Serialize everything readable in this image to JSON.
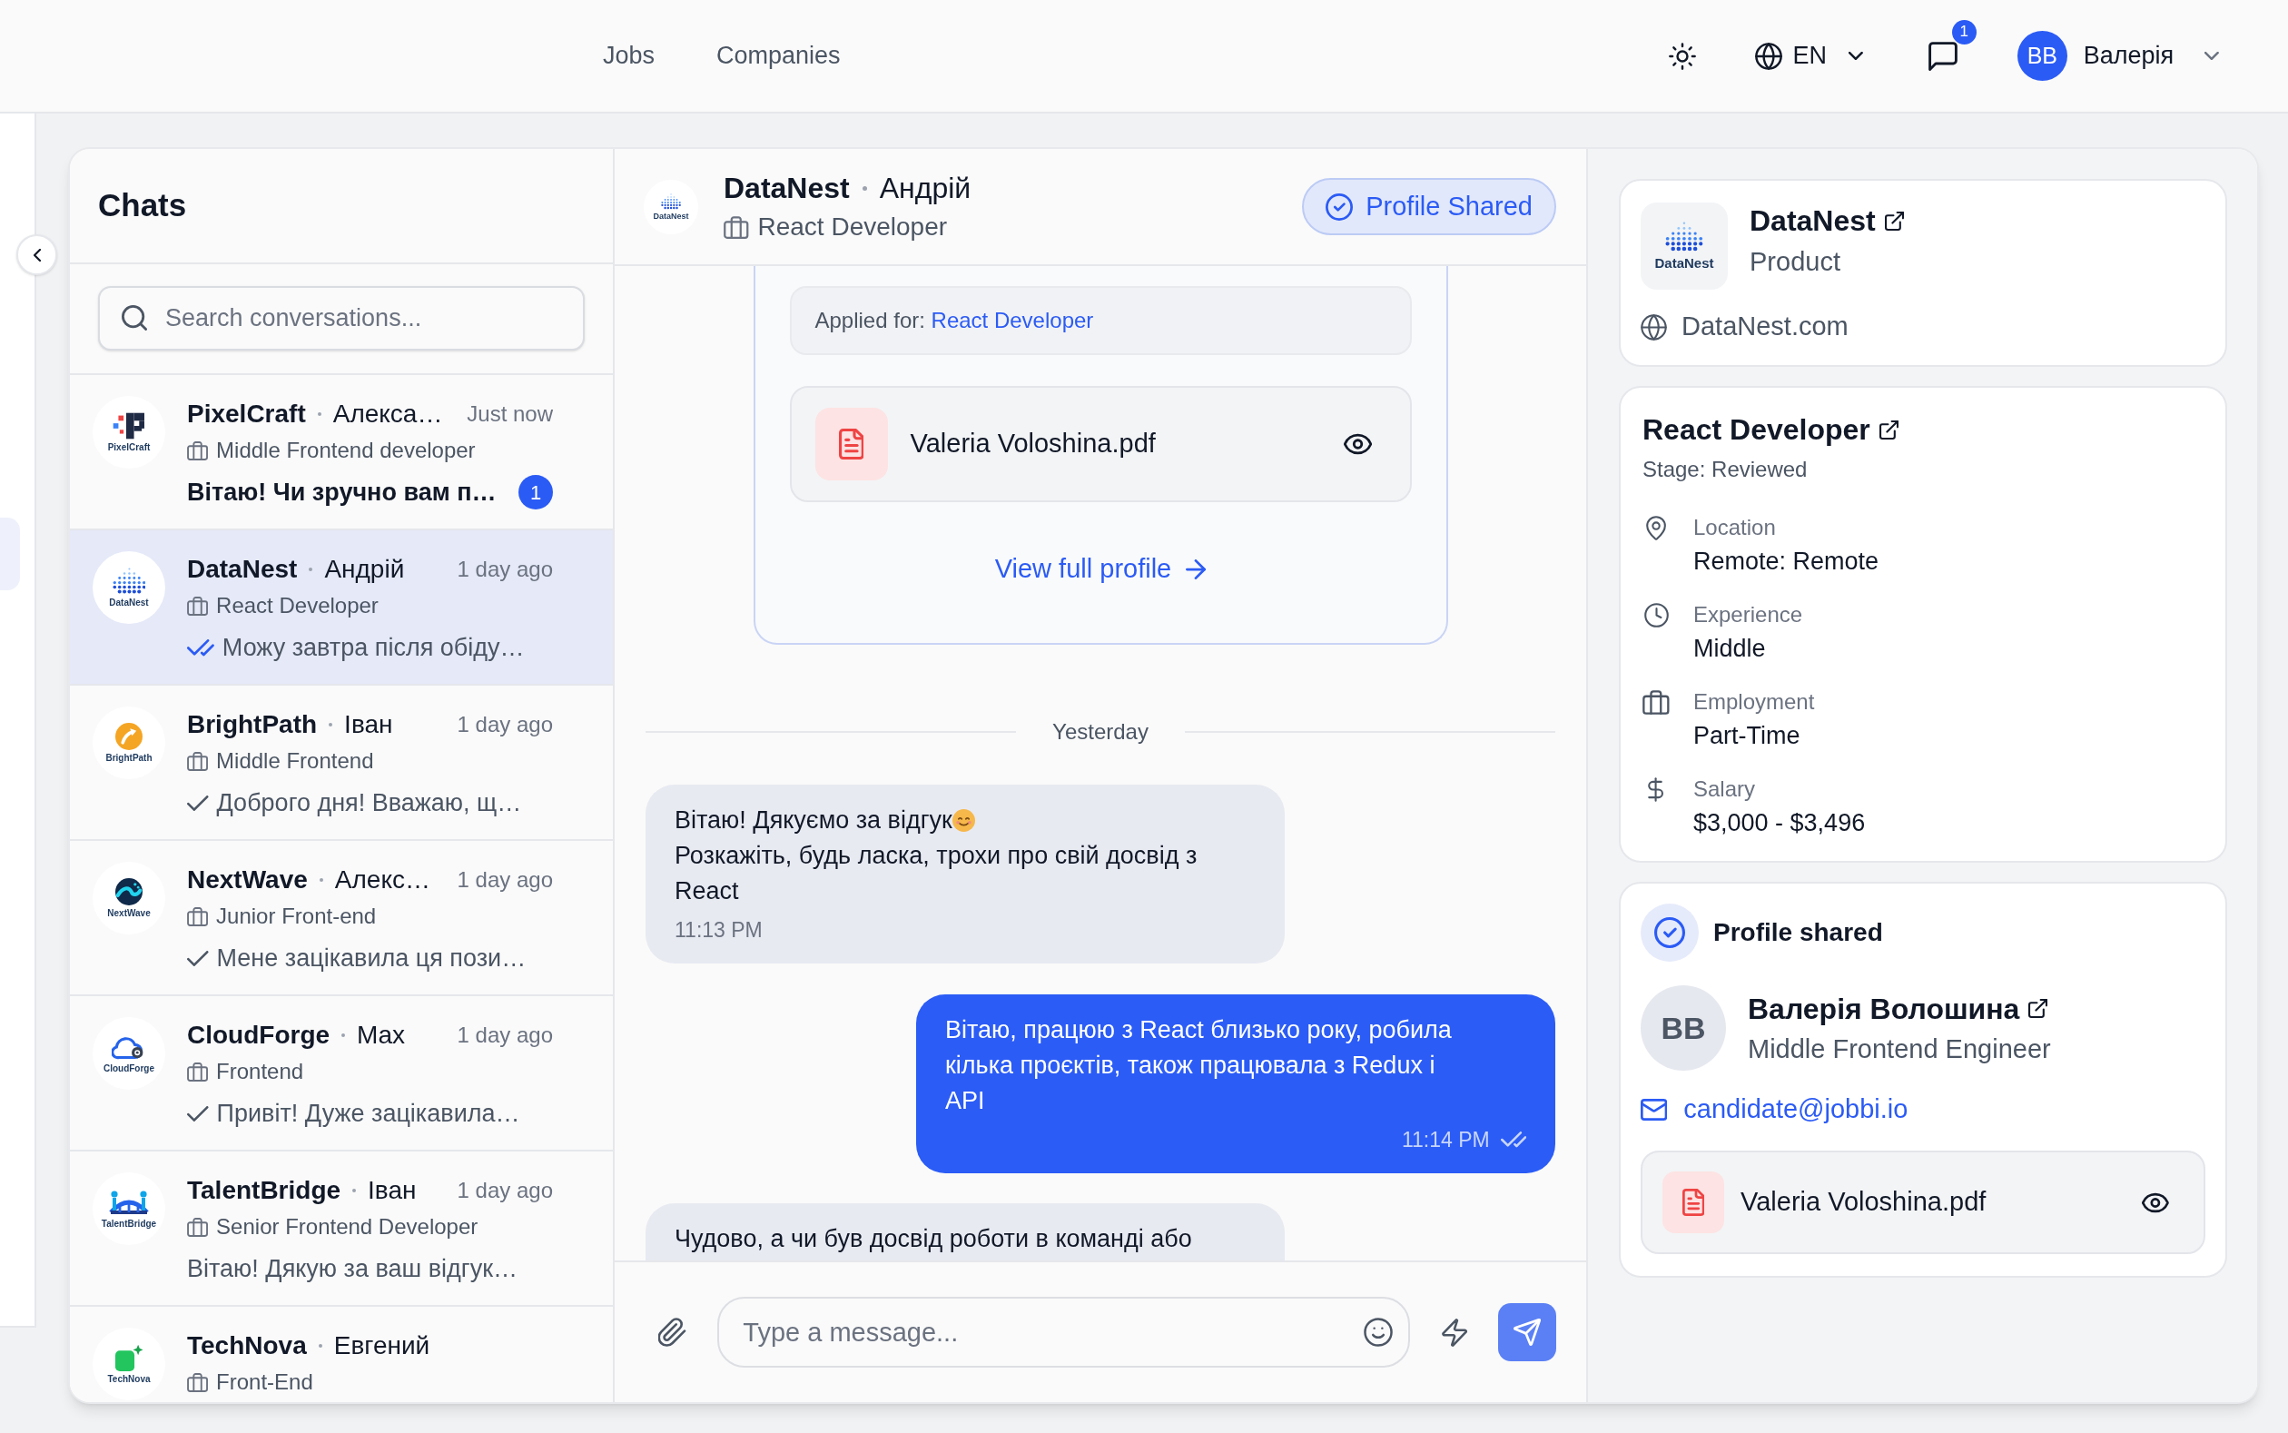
{
  "top_bar": {
    "nav": [
      {
        "label": "Jobs"
      },
      {
        "label": "Companies"
      }
    ],
    "language": "EN",
    "messages_badge": "1",
    "user": {
      "initials": "BB",
      "name": "Валерія"
    }
  },
  "chats": {
    "title": "Chats",
    "search": {
      "placeholder": "Search conversations..."
    },
    "items": [
      {
        "logo": {
          "kind": "pixel",
          "text": "PixelCraft"
        },
        "company": "PixelCraft",
        "contact": "Алекса…",
        "time": "Just now",
        "role": "Middle Frontend developer",
        "message": "Вітаю! Чи зручно вам п…",
        "unread": true,
        "badge": "1",
        "selected": false
      },
      {
        "logo": {
          "kind": "dots",
          "text": "DataNest"
        },
        "company": "DataNest",
        "contact": "Андрій",
        "time": "1 day ago",
        "role": "React Developer",
        "message": "Можу завтра після обіду…",
        "read": true,
        "unread": false,
        "selected": true
      },
      {
        "logo": {
          "kind": "arrow",
          "text": "BrightPath"
        },
        "company": "BrightPath",
        "contact": "Іван",
        "time": "1 day ago",
        "role": "Middle Frontend",
        "message": "Доброго дня! Вважаю, щ…",
        "read": false,
        "unread": false,
        "selected": false
      },
      {
        "logo": {
          "kind": "wave",
          "text": "NextWave"
        },
        "company": "NextWave",
        "contact": "Алекс…",
        "time": "1 day ago",
        "role": "Junior Front-end",
        "message": "Мене зацікавила ця пози…",
        "read": false,
        "unread": false,
        "selected": false
      },
      {
        "logo": {
          "kind": "cloud",
          "text": "CloudForge"
        },
        "company": "CloudForge",
        "contact": "Max",
        "time": "1 day ago",
        "role": "Frontend",
        "message": "Привіт! Дуже зацікавила…",
        "read": false,
        "unread": false,
        "selected": false
      },
      {
        "logo": {
          "kind": "bridge",
          "text": "TalentBridge"
        },
        "company": "TalentBridge",
        "contact": "Іван",
        "time": "1 day ago",
        "role": "Senior Frontend Developer",
        "message": "Вітаю! Дякую за ваш відгук…",
        "unread": false,
        "selected": false
      },
      {
        "logo": {
          "kind": "star",
          "text": "TechNova"
        },
        "company": "TechNova",
        "contact": "Евгений",
        "role": "Front-End",
        "selected": false
      }
    ]
  },
  "conversation": {
    "logo": {
      "kind": "dots",
      "text": "DataNest"
    },
    "company": "DataNest",
    "contact": "Андрій",
    "role": "React Developer",
    "status_button": "Profile Shared",
    "messages": [
      {
        "kind": "shared_profile",
        "applied_label": "Applied for:",
        "applied_job": "React Developer",
        "file": "Valeria Voloshina.pdf",
        "link": "View full profile"
      },
      {
        "kind": "date",
        "text": "Yesterday"
      },
      {
        "kind": "incoming",
        "paragraphs": [
          {
            "text": "Вітаю! Дякуємо за відгук",
            "emoji": true
          },
          {
            "text": "Розкажіть, будь ласка, трохи про свій досвід з React",
            "emoji": false
          }
        ],
        "time": "11:13 PM"
      },
      {
        "kind": "outgoing",
        "paragraphs": [
          {
            "text": "Вітаю, працюю з React близько року, робила кілька проєктів, також працювала з Redux і API",
            "emoji": false
          }
        ],
        "time": "11:14 PM",
        "read": true
      },
      {
        "kind": "incoming",
        "paragraphs": [
          {
            "text": "Чудово, а чи був досвід роботи в команді або",
            "emoji": false
          }
        ]
      }
    ],
    "composer": {
      "placeholder": "Type a message...",
      "send_disabled": true
    }
  },
  "details": {
    "company_card": {
      "logo": {
        "kind": "dots",
        "text": "DataNest"
      },
      "name": "DataNest",
      "category": "Product",
      "website": "DataNest.com"
    },
    "job_card": {
      "title": "React Developer",
      "stage": "Stage: Reviewed",
      "fields": [
        {
          "kind": "location",
          "label": "Location",
          "value": "Remote: Remote"
        },
        {
          "kind": "experience",
          "label": "Experience",
          "value": "Middle"
        },
        {
          "kind": "employment",
          "label": "Employment",
          "value": "Part-Time"
        },
        {
          "kind": "salary",
          "label": "Salary",
          "value": "$3,000 - $3,496"
        }
      ]
    },
    "profile_card": {
      "title": "Profile shared",
      "initials": "BB",
      "name": "Валерія Волошина",
      "headline": "Middle Frontend Engineer",
      "email": "candidate@jobbi.io",
      "file": "Valeria Voloshina.pdf"
    }
  }
}
